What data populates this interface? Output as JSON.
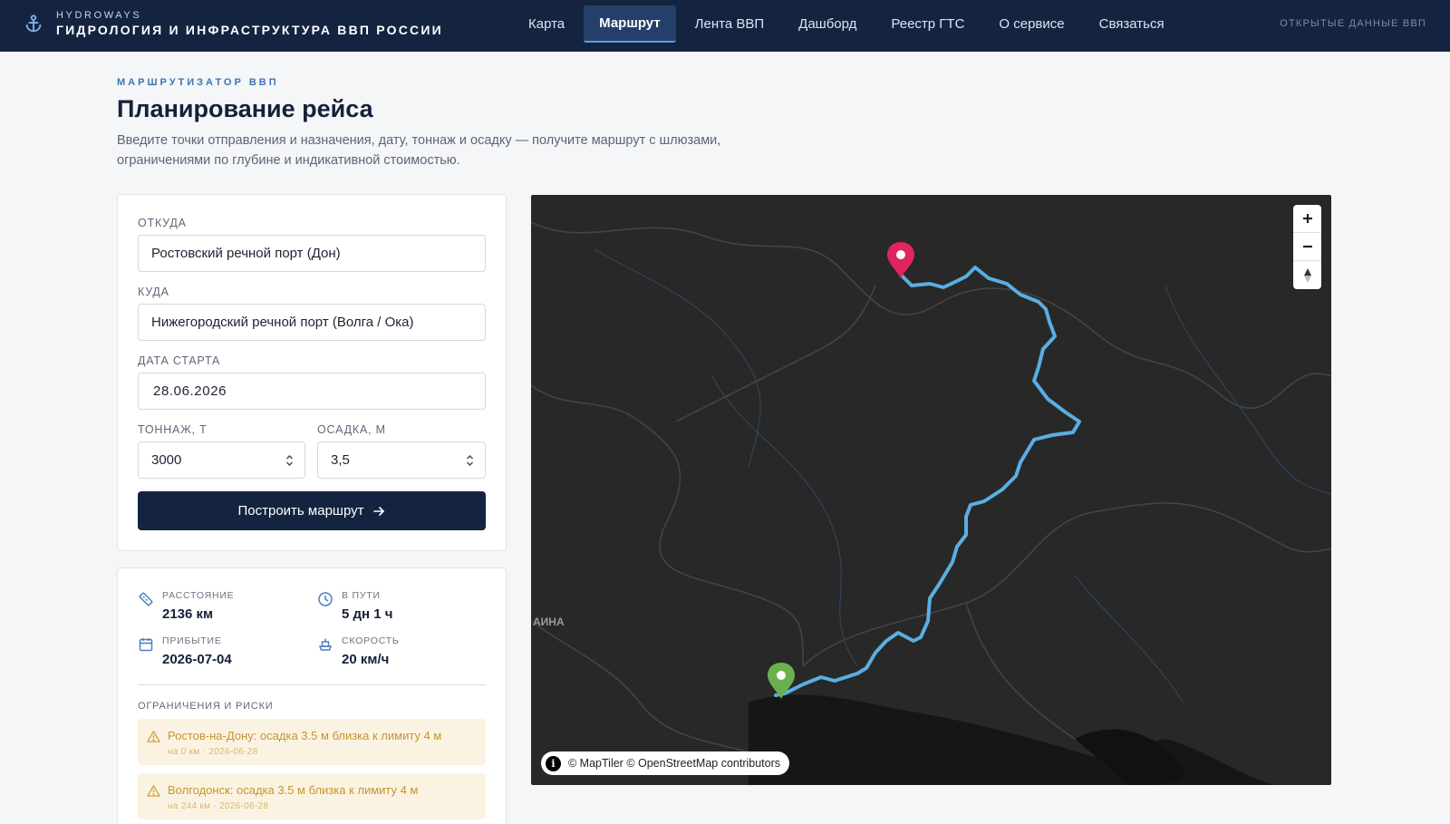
{
  "app": {
    "brand_sub": "HYDROWAYS",
    "brand_title": "ГИДРОЛОГИЯ И ИНФРАСТРУКТУРА ВВП РОССИИ",
    "open_data": "ОТКРЫТЫЕ ДАННЫЕ ВВП"
  },
  "nav": {
    "items": [
      {
        "label": "Карта",
        "active": false
      },
      {
        "label": "Маршрут",
        "active": true
      },
      {
        "label": "Лента ВВП",
        "active": false
      },
      {
        "label": "Дашборд",
        "active": false
      },
      {
        "label": "Реестр ГТС",
        "active": false
      },
      {
        "label": "О сервисе",
        "active": false
      },
      {
        "label": "Связаться",
        "active": false
      }
    ]
  },
  "header": {
    "eyebrow": "МАРШРУТИЗАТОР ВВП",
    "title": "Планирование рейса",
    "description": "Введите точки отправления и назначения, дату, тоннаж и осадку — получите маршрут с шлюзами, ограничениями по глубине и индикативной стоимостью."
  },
  "form": {
    "from_label": "ОТКУДА",
    "from_value": "Ростовский речной порт (Дон)",
    "to_label": "КУДА",
    "to_value": "Нижегородский речной порт (Волга / Ока)",
    "date_label": "ДАТА СТАРТА",
    "date_value": "28.06.2026",
    "tonnage_label": "ТОННАЖ, Т",
    "tonnage_value": "3000",
    "draft_label": "ОСАДКА, М",
    "draft_value": "3,5",
    "submit_label": "Построить маршрут"
  },
  "result": {
    "distance_label": "РАССТОЯНИЕ",
    "distance_value": "2136 км",
    "duration_label": "В ПУТИ",
    "duration_value": "5 дн 1 ч",
    "arrival_label": "ПРИБЫТИЕ",
    "arrival_value": "2026-07-04",
    "speed_label": "СКОРОСТЬ",
    "speed_value": "20 км/ч",
    "risks_title": "ОГРАНИЧЕНИЯ И РИСКИ",
    "risks": [
      {
        "text": "Ростов-на-Дону: осадка 3.5 м близка к лимиту 4 м",
        "meta": "на 0 км · 2026-06-28"
      },
      {
        "text": "Волгодонск: осадка 3.5 м близка к лимиту 4 м",
        "meta": "на 244 км · 2026-06-28"
      }
    ]
  },
  "map": {
    "country_label": "АИНА",
    "attribution": "© MapTiler © OpenStreetMap contributors",
    "zoom_in": "+",
    "zoom_out": "−",
    "colors": {
      "route": "#5aaee3",
      "start_marker": "#6ab04c",
      "end_marker": "#e0245e",
      "background": "#282828"
    }
  }
}
